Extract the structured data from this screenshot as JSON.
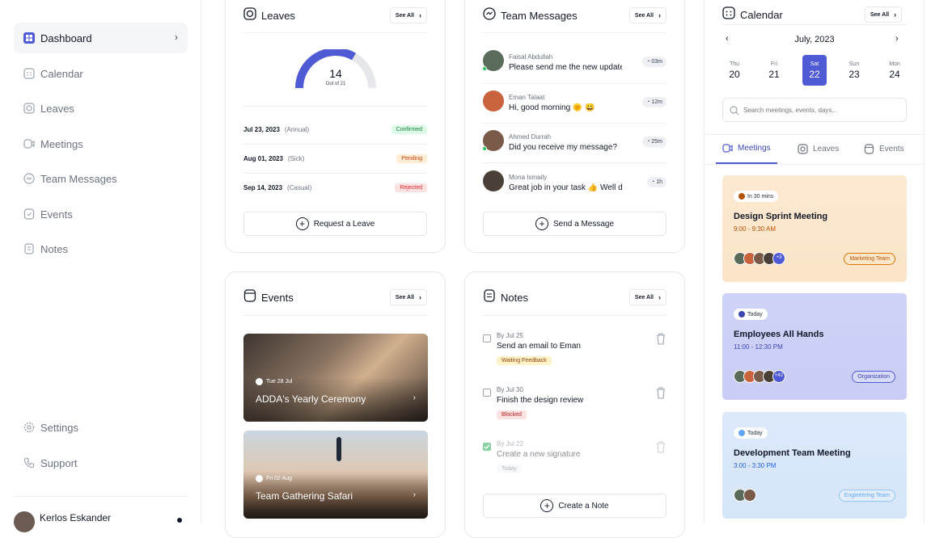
{
  "sidebar": {
    "items": [
      {
        "label": "Dashboard",
        "icon": "dashboard-icon"
      },
      {
        "label": "Calendar",
        "icon": "calendar-icon"
      },
      {
        "label": "Leaves",
        "icon": "leaves-icon"
      },
      {
        "label": "Meetings",
        "icon": "meetings-icon"
      },
      {
        "label": "Team Messages",
        "icon": "messages-icon"
      },
      {
        "label": "Events",
        "icon": "events-icon"
      },
      {
        "label": "Notes",
        "icon": "notes-icon"
      }
    ],
    "bottom": [
      {
        "label": "Settings",
        "icon": "gear-icon"
      },
      {
        "label": "Support",
        "icon": "phone-icon"
      }
    ],
    "user": {
      "name": "Kerlos Eskander"
    }
  },
  "see_all": "See All",
  "leaves": {
    "title": "Leaves",
    "used": "14",
    "total_label": "Out of 21",
    "used_fraction": 0.667,
    "rows": [
      {
        "date": "Jul 23, 2023",
        "kind": "(Annual)",
        "status": "Confirmed"
      },
      {
        "date": "Aug 01, 2023",
        "kind": "(Sick)",
        "status": "Pending"
      },
      {
        "date": "Sep 14, 2023",
        "kind": "(Casual)",
        "status": "Rejected"
      }
    ],
    "button": "Request a Leave"
  },
  "messages": {
    "title": "Team Messages",
    "items": [
      {
        "name": "Faisal Abdullah",
        "text": "Please send me the new update",
        "time": "03m"
      },
      {
        "name": "Eman Talaat",
        "text": "Hi, good morning 🌞 😀",
        "time": "12m"
      },
      {
        "name": "Ahmed Durrah",
        "text": "Did you receive my message?",
        "time": "25m"
      },
      {
        "name": "Mona Ismaily",
        "text": "Great job in your task 👍 Well done",
        "time": "1h"
      }
    ],
    "button": "Send a Message"
  },
  "calendar": {
    "title": "Calendar",
    "month": "July, 2023",
    "days": [
      {
        "name": "Thu",
        "num": "20"
      },
      {
        "name": "Fri",
        "num": "21"
      },
      {
        "name": "Sat",
        "num": "22"
      },
      {
        "name": "Sun",
        "num": "23"
      },
      {
        "name": "Mon",
        "num": "24"
      }
    ],
    "selected_day": "22",
    "search_placeholder": "Search meetings, events, days...",
    "tabs": [
      "Meetings",
      "Leaves",
      "Events"
    ],
    "meetings": [
      {
        "when": "In 30 mins",
        "title": "Design Sprint Meeting",
        "time": "9:00 - 9:30 AM",
        "extra": "+3",
        "team": "Marketing Team"
      },
      {
        "when": "Today",
        "title": "Employees All Hands",
        "time": "11:00 - 12:30 PM",
        "extra": "+42",
        "team": "Organization"
      },
      {
        "when": "Today",
        "title": "Development Team Meeting",
        "time": "3:00 - 3:30 PM",
        "extra": "",
        "team": "Engineering Team"
      }
    ]
  },
  "events": {
    "title": "Events",
    "items": [
      {
        "date": "Tue 28 Jul",
        "name": "ADDA's Yearly Ceremony"
      },
      {
        "date": "Fri 02 Aug",
        "name": "Team Gathering Safari"
      }
    ]
  },
  "notes": {
    "title": "Notes",
    "items": [
      {
        "by": "By Jul 25",
        "title": "Send an email to Eman",
        "tag": "Waiting Feedback",
        "done": false
      },
      {
        "by": "By Jul 30",
        "title": "Finish the design review",
        "tag": "Blocked",
        "done": false
      },
      {
        "by": "By Jul 22",
        "title": "Create a new signature",
        "tag": "Today",
        "done": true
      }
    ],
    "button": "Create a Note"
  },
  "colors": {
    "accent": "#4f5bd5",
    "confirmed": "#16a34a",
    "pending": "#c2410c",
    "rejected": "#dc2626"
  }
}
